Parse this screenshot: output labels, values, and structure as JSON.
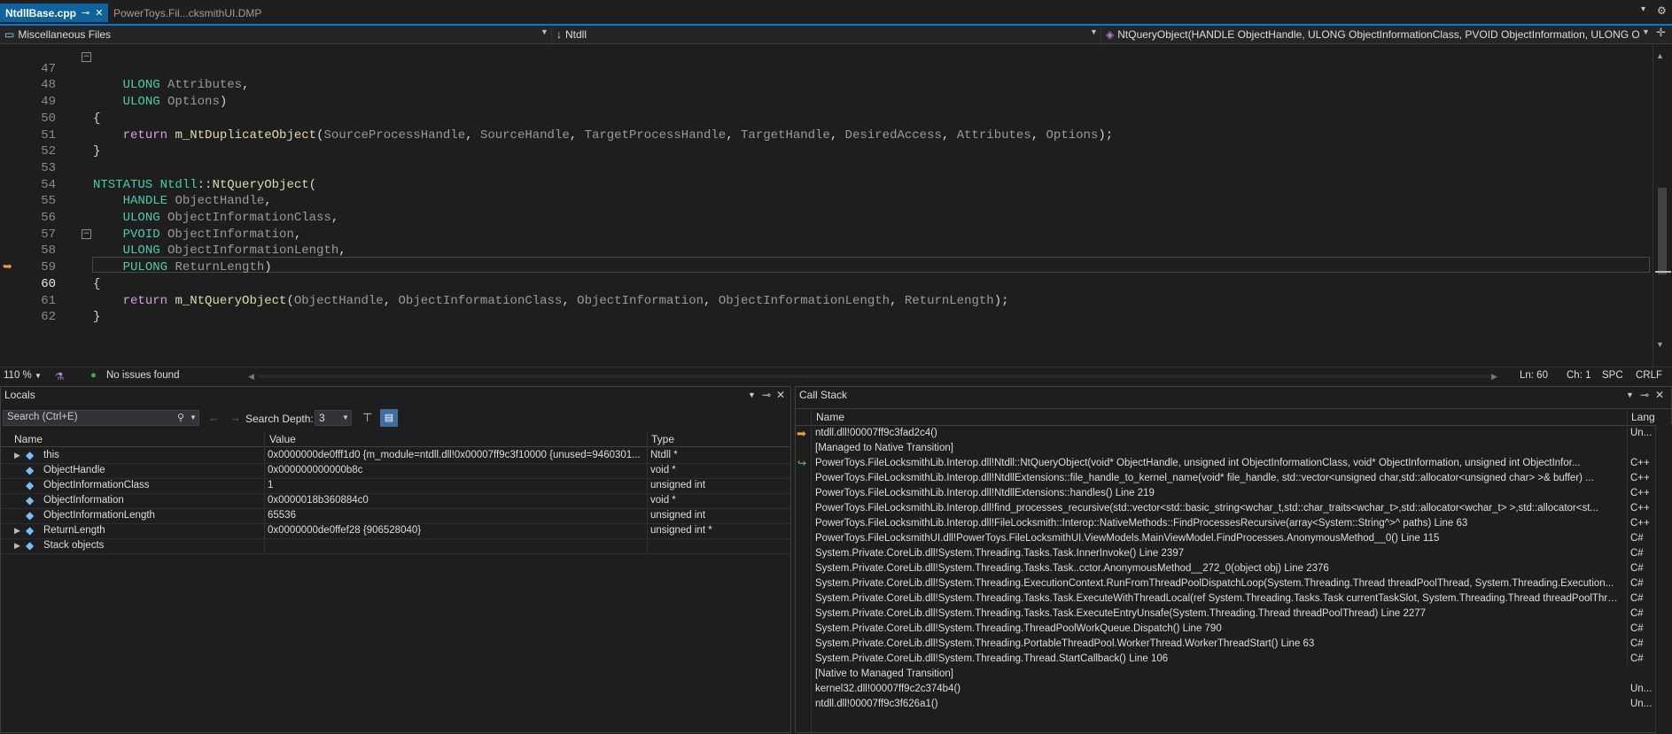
{
  "tabs": [
    {
      "label": "NtdllBase.cpp",
      "active": true
    },
    {
      "label": "PowerToys.Fil...cksmithUI.DMP",
      "active": false
    }
  ],
  "navbar": {
    "project": "Miscellaneous Files",
    "scope": "Ntdll",
    "member": "NtQueryObject(HANDLE ObjectHandle, ULONG ObjectInformationClass, PVOID ObjectInformation, ULONG Ob"
  },
  "editor": {
    "current_line": "60",
    "lines": [
      {
        "num": "47",
        "text": "    ULONG Attributes,"
      },
      {
        "num": "48",
        "text": "    ULONG Options)"
      },
      {
        "num": "49",
        "text": "{"
      },
      {
        "num": "50",
        "text": "    return m_NtDuplicateObject(SourceProcessHandle, SourceHandle, TargetProcessHandle, TargetHandle, DesiredAccess, Attributes, Options);"
      },
      {
        "num": "51",
        "text": "}"
      },
      {
        "num": "52",
        "text": ""
      },
      {
        "num": "53",
        "text": "NTSTATUS Ntdll::NtQueryObject("
      },
      {
        "num": "54",
        "text": "    HANDLE ObjectHandle,"
      },
      {
        "num": "55",
        "text": "    ULONG ObjectInformationClass,"
      },
      {
        "num": "56",
        "text": "    PVOID ObjectInformation,"
      },
      {
        "num": "57",
        "text": "    ULONG ObjectInformationLength,"
      },
      {
        "num": "58",
        "text": "    PULONG ReturnLength)"
      },
      {
        "num": "59",
        "text": "{"
      },
      {
        "num": "60",
        "text": "    return m_NtQueryObject(ObjectHandle, ObjectInformationClass, ObjectInformation, ObjectInformationLength, ReturnLength);"
      },
      {
        "num": "61",
        "text": "}"
      },
      {
        "num": "62",
        "text": ""
      }
    ]
  },
  "editor_status": {
    "zoom": "110 %",
    "issues": "No issues found",
    "ln": "Ln: 60",
    "ch": "Ch: 1",
    "spc": "SPC",
    "eol": "CRLF"
  },
  "locals": {
    "title": "Locals",
    "search_placeholder": "Search (Ctrl+E)",
    "search_depth_label": "Search Depth:",
    "search_depth_value": "3",
    "columns": {
      "name": "Name",
      "value": "Value",
      "type": "Type"
    },
    "rows": [
      {
        "name": "this",
        "value": "0x0000000de0fff1d0 {m_module=ntdll.dll!0x00007ff9c3f10000 {unused=9460301...",
        "type": "Ntdll *",
        "expandable": true
      },
      {
        "name": "ObjectHandle",
        "value": "0x000000000000b8c",
        "type": "void *",
        "expandable": false
      },
      {
        "name": "ObjectInformationClass",
        "value": "1",
        "type": "unsigned int",
        "expandable": false
      },
      {
        "name": "ObjectInformation",
        "value": "0x0000018b360884c0",
        "type": "void *",
        "expandable": false
      },
      {
        "name": "ObjectInformationLength",
        "value": "65536",
        "type": "unsigned int",
        "expandable": false
      },
      {
        "name": "ReturnLength",
        "value": "0x0000000de0ffef28 {906528040}",
        "type": "unsigned int *",
        "expandable": true
      },
      {
        "name": "Stack objects",
        "value": "",
        "type": "",
        "expandable": true
      }
    ]
  },
  "callstack": {
    "title": "Call Stack",
    "columns": {
      "name": "Name",
      "lang": "Lang"
    },
    "rows": [
      {
        "name": "ntdll.dll!00007ff9c3fad2c4()",
        "lang": "Un...",
        "marker": "current"
      },
      {
        "name": "[Managed to Native Transition]",
        "lang": "",
        "marker": ""
      },
      {
        "name": "PowerToys.FileLocksmithLib.Interop.dll!Ntdll::NtQueryObject(void* ObjectHandle, unsigned int ObjectInformationClass, void* ObjectInformation, unsigned int ObjectInfor...",
        "lang": "C++",
        "marker": "return"
      },
      {
        "name": "PowerToys.FileLocksmithLib.Interop.dll!NtdllExtensions::file_handle_to_kernel_name(void* file_handle, std::vector<unsigned char,std::allocator<unsigned char> >& buffer) ...",
        "lang": "C++",
        "marker": ""
      },
      {
        "name": "PowerToys.FileLocksmithLib.Interop.dll!NtdllExtensions::handles() Line 219",
        "lang": "C++",
        "marker": ""
      },
      {
        "name": "PowerToys.FileLocksmithLib.Interop.dll!find_processes_recursive(std::vector<std::basic_string<wchar_t,std::char_traits<wchar_t>,std::allocator<wchar_t> >,std::allocator<st...",
        "lang": "C++",
        "marker": ""
      },
      {
        "name": "PowerToys.FileLocksmithLib.Interop.dll!FileLocksmith::Interop::NativeMethods::FindProcessesRecursive(array<System::String^>^ paths) Line 63",
        "lang": "C++",
        "marker": ""
      },
      {
        "name": "PowerToys.FileLocksmithUI.dll!PowerToys.FileLocksmithUI.ViewModels.MainViewModel.FindProcesses.AnonymousMethod__0() Line 115",
        "lang": "C#",
        "marker": ""
      },
      {
        "name": "System.Private.CoreLib.dll!System.Threading.Tasks.Task.InnerInvoke() Line 2397",
        "lang": "C#",
        "marker": ""
      },
      {
        "name": "System.Private.CoreLib.dll!System.Threading.Tasks.Task..cctor.AnonymousMethod__272_0(object obj) Line 2376",
        "lang": "C#",
        "marker": ""
      },
      {
        "name": "System.Private.CoreLib.dll!System.Threading.ExecutionContext.RunFromThreadPoolDispatchLoop(System.Threading.Thread threadPoolThread, System.Threading.Execution...",
        "lang": "C#",
        "marker": ""
      },
      {
        "name": "System.Private.CoreLib.dll!System.Threading.Tasks.Task.ExecuteWithThreadLocal(ref System.Threading.Tasks.Task currentTaskSlot, System.Threading.Thread threadPoolThrea...",
        "lang": "C#",
        "marker": ""
      },
      {
        "name": "System.Private.CoreLib.dll!System.Threading.Tasks.Task.ExecuteEntryUnsafe(System.Threading.Thread threadPoolThread) Line 2277",
        "lang": "C#",
        "marker": ""
      },
      {
        "name": "System.Private.CoreLib.dll!System.Threading.ThreadPoolWorkQueue.Dispatch() Line 790",
        "lang": "C#",
        "marker": ""
      },
      {
        "name": "System.Private.CoreLib.dll!System.Threading.PortableThreadPool.WorkerThread.WorkerThreadStart() Line 63",
        "lang": "C#",
        "marker": ""
      },
      {
        "name": "System.Private.CoreLib.dll!System.Threading.Thread.StartCallback() Line 106",
        "lang": "C#",
        "marker": ""
      },
      {
        "name": "[Native to Managed Transition]",
        "lang": "",
        "marker": ""
      },
      {
        "name": "kernel32.dll!00007ff9c2c374b4()",
        "lang": "Un...",
        "marker": ""
      },
      {
        "name": "ntdll.dll!00007ff9c3f626a1()",
        "lang": "Un...",
        "marker": ""
      }
    ]
  },
  "colors": {
    "accent": "#0078d4",
    "keyword": "#4ec9b0",
    "function": "#dcdcaa",
    "parameter": "#9a9a9a",
    "control": "#d8a0df",
    "ok": "#3ea84a",
    "arrow": "#e8a33d"
  }
}
